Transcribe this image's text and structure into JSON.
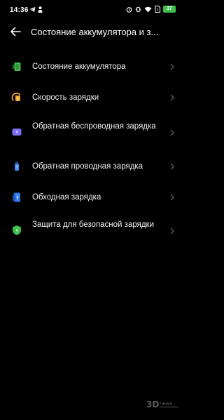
{
  "status_bar": {
    "time": "14:36",
    "battery_level": "37"
  },
  "header": {
    "title": "Состояние аккумулятора и з..."
  },
  "menu": {
    "items": [
      {
        "label": "Состояние аккумулятора",
        "icon": "battery-status-icon",
        "color": "#3fbf4a"
      },
      {
        "label": "Скорость зарядки",
        "icon": "charging-speed-icon",
        "color": "#f2a52b"
      },
      {
        "label": "Обратная беспроводная зарядка",
        "icon": "reverse-wireless-charging-icon",
        "color": "#7b6cf0"
      },
      {
        "label": "Обратная проводная зарядка",
        "icon": "reverse-wired-charging-icon",
        "color": "#3e8ef0"
      },
      {
        "label": "Обходная зарядка",
        "icon": "bypass-charging-icon",
        "color": "#2f7bf0"
      },
      {
        "label": "Защита для безопасной зарядки",
        "icon": "safe-charging-protection-icon",
        "color": "#3fbf4a"
      }
    ]
  },
  "watermark": {
    "text": "3DNews"
  }
}
